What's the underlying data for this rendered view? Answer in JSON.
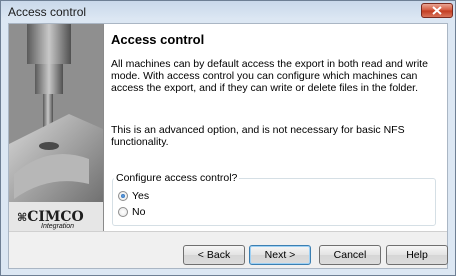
{
  "window": {
    "title": "Access control",
    "close_icon": "close-icon"
  },
  "logo": {
    "brand": "CIMCO",
    "sub": "Integration"
  },
  "content": {
    "heading": "Access control",
    "description": "All machines can by default access the export in both read and write mode. With access control you can configure which machines can access the export, and if they can write or delete files in the folder.",
    "note": "This is an advanced option, and is not necessary for basic NFS functionality.",
    "group_label": "Configure access control?",
    "options": [
      {
        "label": "Yes",
        "selected": true
      },
      {
        "label": "No",
        "selected": false
      }
    ]
  },
  "buttons": {
    "back": "< Back",
    "next": "Next >",
    "cancel": "Cancel",
    "help": "Help"
  }
}
